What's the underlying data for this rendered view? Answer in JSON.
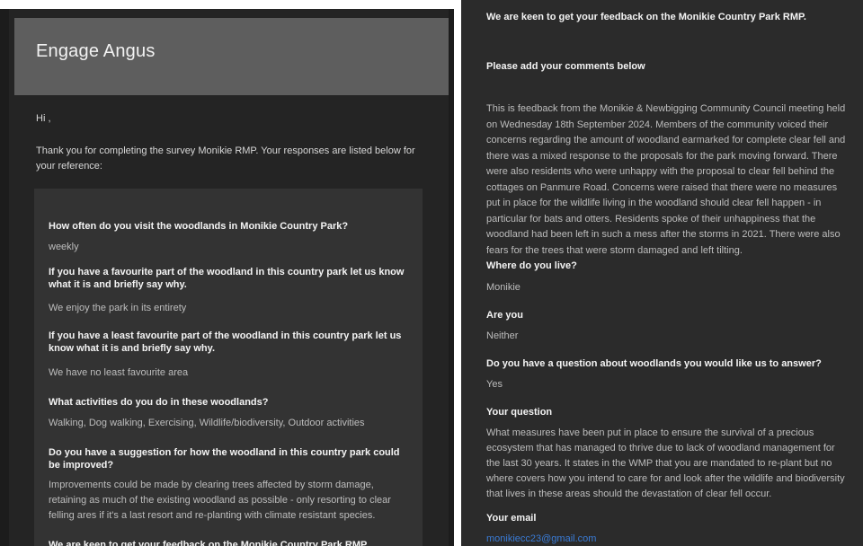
{
  "left": {
    "header_title": "Engage Angus",
    "greeting": "Hi ,",
    "intro": "Thank you for completing the survey Monikie RMP. Your responses are listed below for your reference:",
    "qa": [
      {
        "q": "How often do you visit the woodlands in Monikie Country Park?",
        "a": "weekly"
      },
      {
        "q": "If you have a favourite part of the woodland in this country park let us know what it is and briefly say why.",
        "a": "We enjoy the park in its entirety"
      },
      {
        "q": "If you have a least favourite part of the woodland in this country park let us know what it is and briefly say why.",
        "a": "We have no least favourite area"
      },
      {
        "q": "What activities do you do in these woodlands?",
        "a": "Walking, Dog walking, Exercising, Wildlife/biodiversity, Outdoor activities"
      },
      {
        "q": "Do you have a suggestion for how the woodland in this country park could be improved?",
        "a": "Improvements could be made by clearing trees affected by storm damage, retaining as much of the existing woodland as possible - only resorting to clear felling ares if it's a last resort and re-planting with climate resistant species."
      },
      {
        "q": "We are keen to get your feedback on the Monikie Country Park RMP.",
        "a": ""
      }
    ]
  },
  "right": {
    "qa": [
      {
        "q": "We are keen to get your feedback on the Monikie Country Park RMP.",
        "a": ""
      },
      {
        "q": "Please add your comments below",
        "a": "This is feedback from the Monikie & Newbigging Community Council meeting held on Wednesday 18th September 2024. Members of the community voiced their concerns regarding the amount of woodland earmarked for complete clear fell and there was a mixed response to the proposals for the park moving forward. There were also residents who were unhappy with the proposal to clear fell behind the cottages on Panmure Road. Concerns were raised that there were no measures put in place for the wildlife living in the woodland should clear fell happen - in particular for bats and otters. Residents spoke of their unhappiness that the woodland had been left in such a mess after the storms in 2021. There were also fears for the trees that were storm damaged and left tilting."
      },
      {
        "q": "Where do you live?",
        "a": "Monikie"
      },
      {
        "q": "Are you",
        "a": "Neither"
      },
      {
        "q": "Do you have a question about woodlands you would like us to answer?",
        "a": "Yes"
      },
      {
        "q": "Your question",
        "a": "What measures have been put in place to ensure the survival of a precious ecosystem that has managed to thrive due to lack of woodland management for the last 30 years. It states in the WMP that you are mandated to re-plant but no where covers how you intend to care for and look after the wildlife and biodiversity that lives in these areas should the devastation of clear fell occur."
      },
      {
        "q": "Your email",
        "a": "monikiecc23@gmail.com"
      }
    ]
  }
}
